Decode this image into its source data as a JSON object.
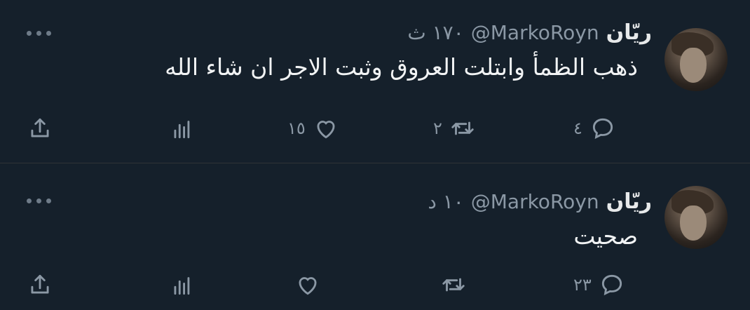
{
  "tweets": [
    {
      "display_name": "ريّان",
      "handle": "@MarkoRoyn",
      "time": "١٧٠ ث",
      "text": "ذهب الظمأ وابتلت العروق وثبت الاجر ان شاء الله",
      "replies": "٤",
      "retweets": "٢",
      "likes": "١٥",
      "views": ""
    },
    {
      "display_name": "ريّان",
      "handle": "@MarkoRoyn",
      "time": "١٠ د",
      "text": "صحيت",
      "replies": "٢٣",
      "retweets": "",
      "likes": "",
      "views": ""
    }
  ],
  "icons": {
    "reply": "comment-icon",
    "retweet": "retweet-icon",
    "like": "heart-icon",
    "views": "views-chart-icon",
    "share": "share-icon",
    "more": "more-dots-icon"
  },
  "colors": {
    "background": "#15202b",
    "text": "#e7e9ea",
    "muted": "#8b98a5",
    "divider": "#2f3336"
  }
}
